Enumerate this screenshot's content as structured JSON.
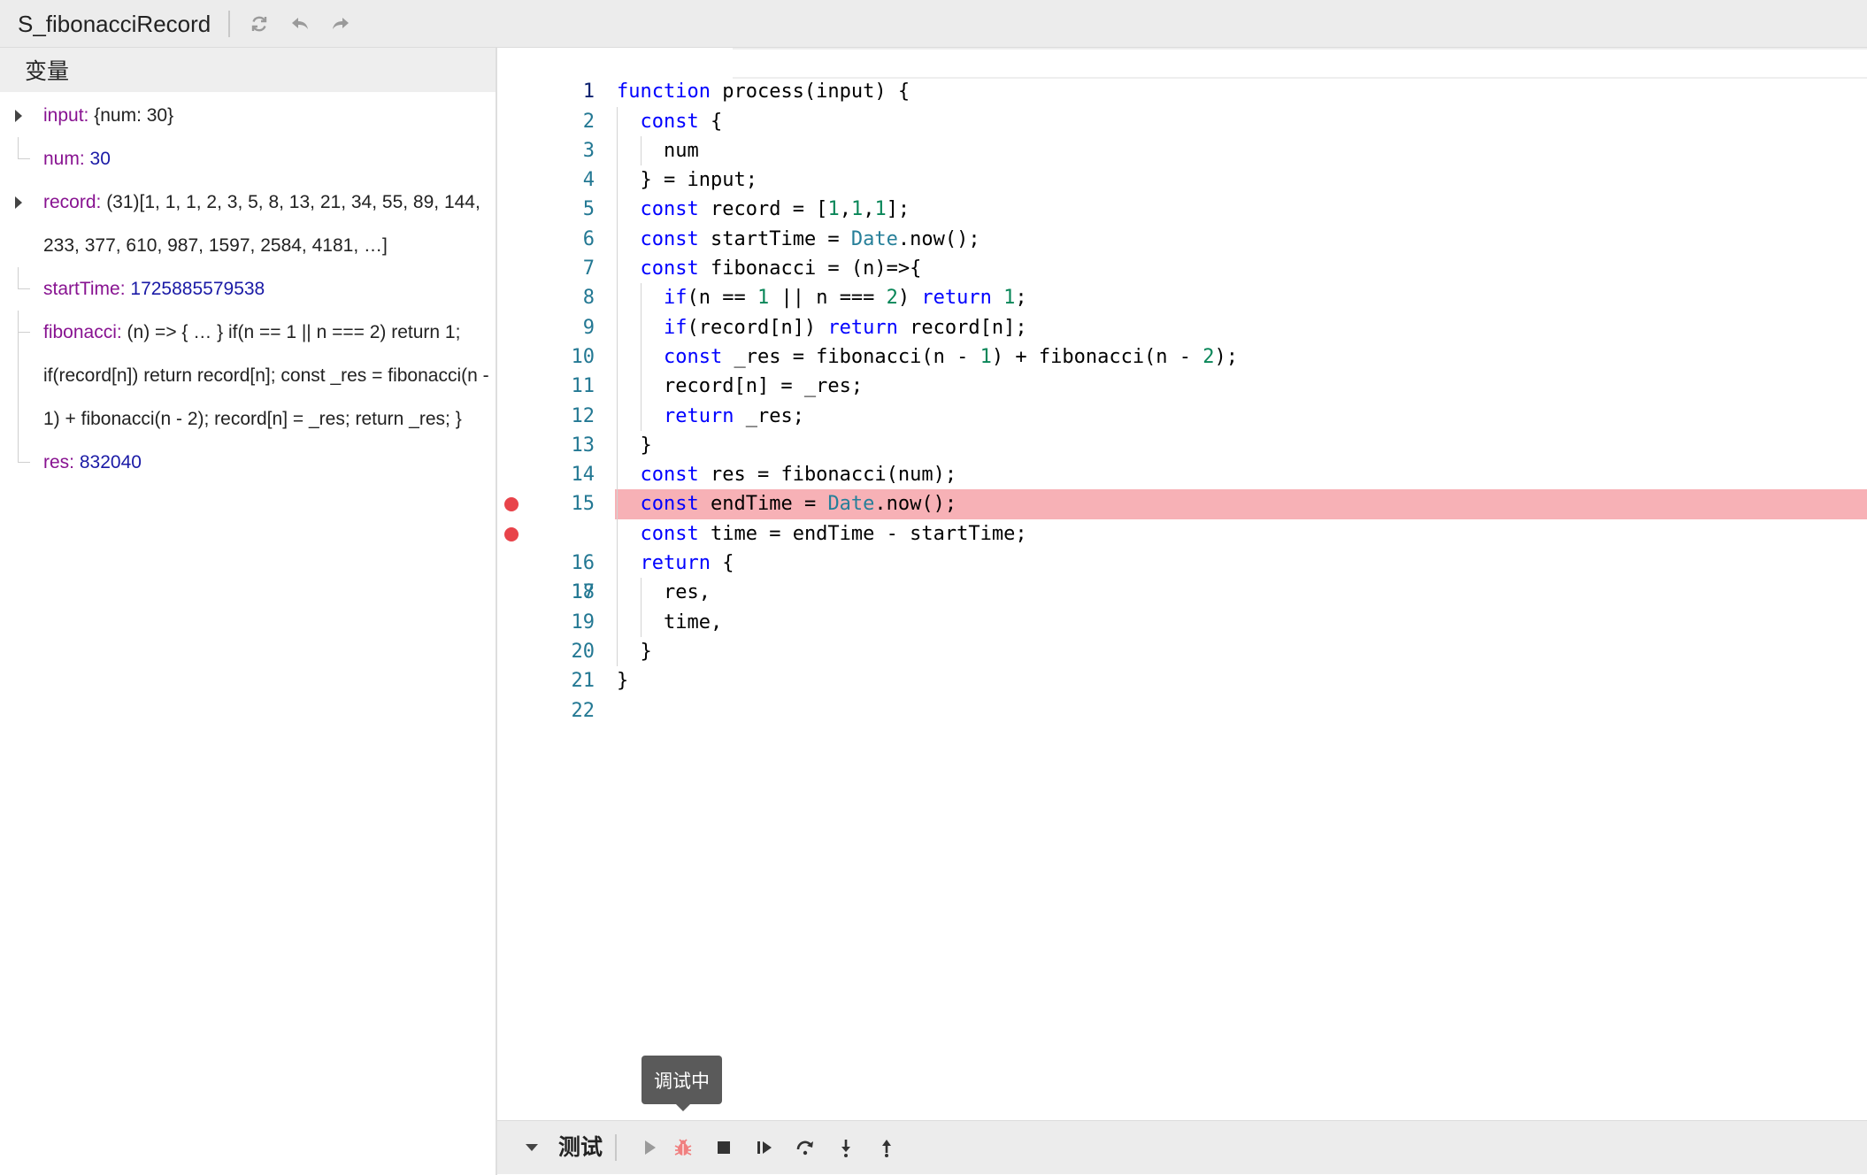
{
  "header": {
    "title": "S_fibonacciRecord"
  },
  "variables_panel": {
    "title": "变量",
    "items": [
      {
        "name": "input:",
        "value": " {num: 30}",
        "expandable": true
      },
      {
        "name": "num:",
        "value": " 30"
      },
      {
        "name": "record:",
        "value": " (31)[1, 1, 1, 2, 3, 5, 8, 13, 21, 34, 55, 89, 144, 233, 377, 610, 987, 1597, 2584, 4181, …]",
        "expandable": true
      },
      {
        "name": "startTime:",
        "value": " 1725885579538"
      },
      {
        "name": "fibonacci:",
        "value": " (n) => { … } if(n == 1 || n === 2) return 1; if(record[n]) return record[n]; const _res = fibonacci(n - 1) + fibonacci(n - 2); record[n] = _res; return _res; }"
      },
      {
        "name": "res:",
        "value": " 832040"
      }
    ]
  },
  "editor": {
    "line_numbers": [
      "1",
      "2",
      "3",
      "4",
      "5",
      "6",
      "7",
      "8",
      "9",
      "10",
      "11",
      "12",
      "13",
      "14",
      "15",
      "16",
      "17",
      "18",
      "19",
      "20",
      "21",
      "22"
    ],
    "breakpoints": [
      16,
      17
    ],
    "highlight_line": 16,
    "active_line": 1
  },
  "tooltip": {
    "text": "调试中"
  },
  "debug_bar": {
    "label": "测试"
  },
  "colors": {
    "keyword": "#0000ff",
    "number": "#098658",
    "class": "#267f99",
    "highlight": "#f7b1b6",
    "breakpoint": "#e8434a",
    "var_name": "#881391",
    "var_number": "#1a1aa6"
  },
  "icons": [
    "refresh-icon",
    "undo-icon",
    "redo-icon",
    "continue-icon",
    "debug-bug-icon",
    "stop-icon",
    "step-icon",
    "step-over-icon",
    "step-into-icon",
    "step-out-icon"
  ]
}
